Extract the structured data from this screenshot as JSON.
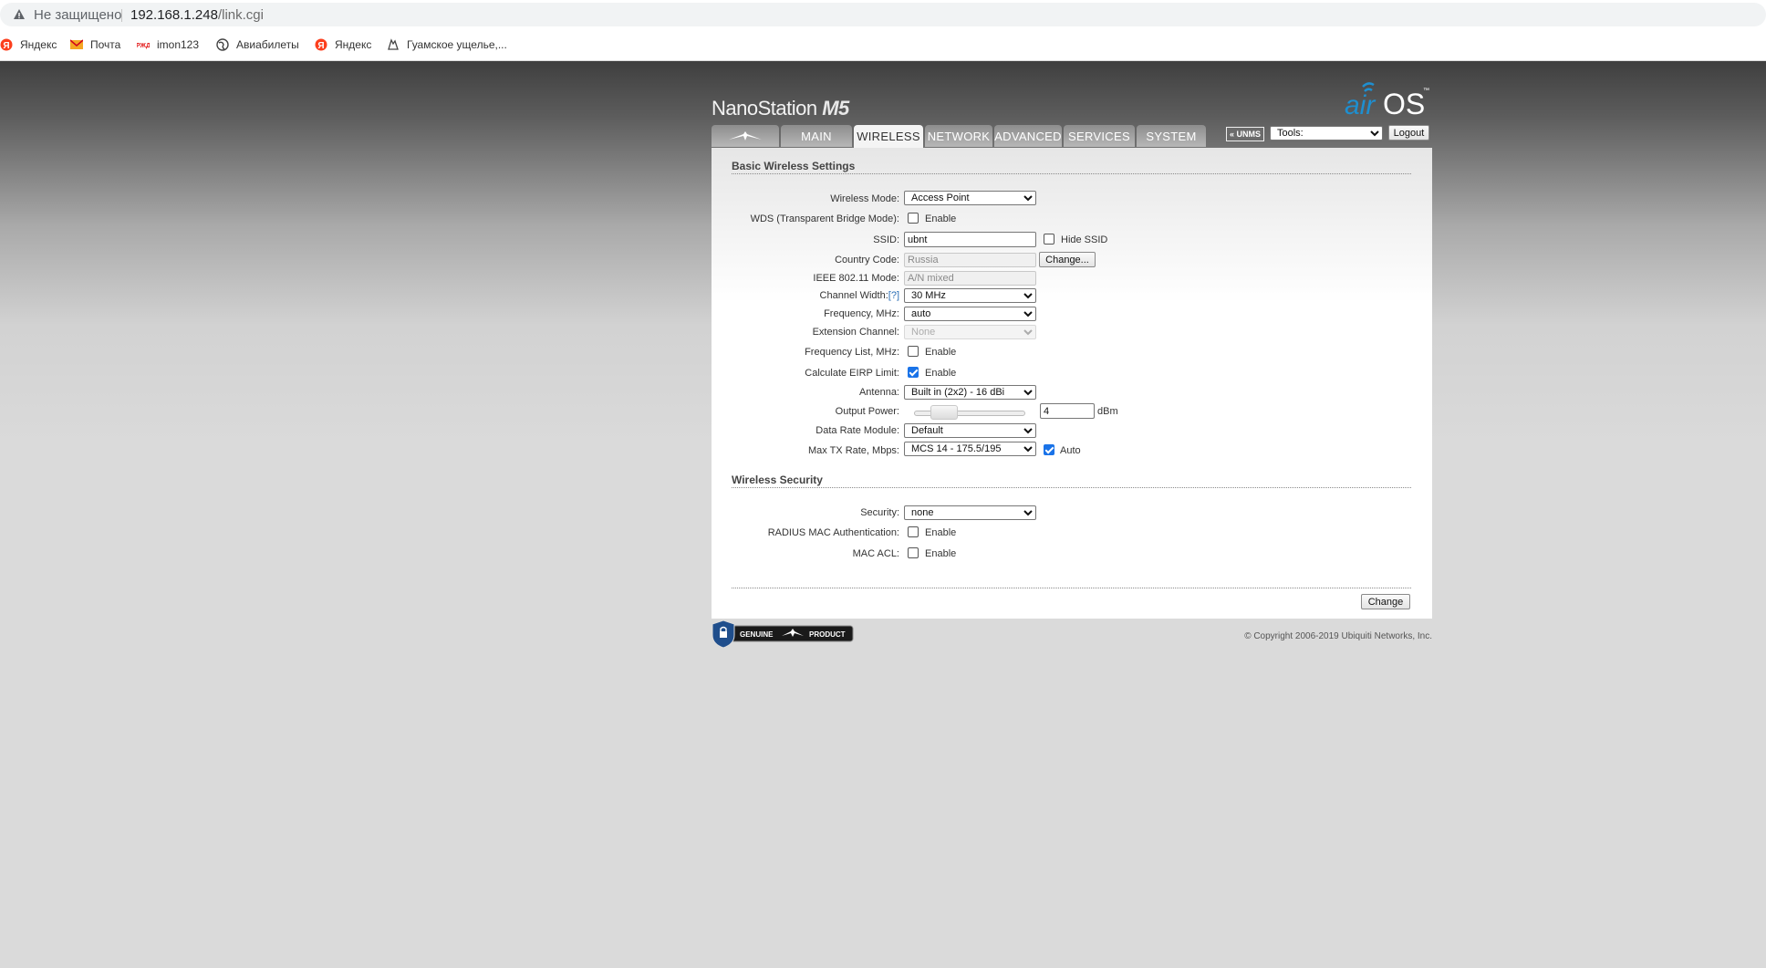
{
  "browser": {
    "security_label": "Не защищено",
    "url_host": "192.168.1.248",
    "url_path": "/link.cgi",
    "bookmarks": [
      {
        "label": "Яндекс",
        "icon": "yandex-icon"
      },
      {
        "label": "Почта",
        "icon": "mail-icon"
      },
      {
        "label": "imon123",
        "icon": "rzd-icon"
      },
      {
        "label": "Авиабилеты",
        "icon": "globe-icon"
      },
      {
        "label": "Яндекс",
        "icon": "yandex-icon"
      },
      {
        "label": "Гуамское ущелье,...",
        "icon": "map-icon"
      }
    ]
  },
  "header": {
    "product_name": "NanoStation",
    "product_model": "M5",
    "brand_air": "air",
    "brand_os": "OS",
    "tm": "™"
  },
  "tabs": [
    "MAIN",
    "WIRELESS",
    "NETWORK",
    "ADVANCED",
    "SERVICES",
    "SYSTEM"
  ],
  "active_tab": "WIRELESS",
  "toolbar": {
    "unms_label": "UNMS",
    "tools_value": "Tools:",
    "logout_label": "Logout"
  },
  "basic": {
    "title": "Basic Wireless Settings",
    "wireless_mode_label": "Wireless Mode:",
    "wireless_mode_value": "Access Point",
    "wds_label": "WDS (Transparent Bridge Mode):",
    "wds_enable_label": "Enable",
    "ssid_label": "SSID:",
    "ssid_value": "ubnt",
    "hide_ssid_label": "Hide SSID",
    "country_code_label": "Country Code:",
    "country_code_value": "Russia",
    "country_change_label": "Change...",
    "ieee_label": "IEEE 802.11 Mode:",
    "ieee_value": "A/N mixed",
    "channel_width_label": "Channel Width:",
    "channel_width_help": "[?]",
    "channel_width_value": "30 MHz",
    "frequency_label": "Frequency, MHz:",
    "frequency_value": "auto",
    "extension_label": "Extension Channel:",
    "extension_value": "None",
    "freq_list_label": "Frequency List, MHz:",
    "freq_list_enable_label": "Enable",
    "eirp_label": "Calculate EIRP Limit:",
    "eirp_enable_label": "Enable",
    "antenna_label": "Antenna:",
    "antenna_value": "Built in (2x2) - 16 dBi",
    "output_power_label": "Output Power:",
    "output_power_value": "4",
    "output_power_unit": "dBm",
    "data_rate_label": "Data Rate Module:",
    "data_rate_value": "Default",
    "max_tx_label": "Max TX Rate, Mbps:",
    "max_tx_value": "MCS 14 - 175.5/195",
    "max_tx_auto_label": "Auto"
  },
  "checks": {
    "wds": false,
    "hide_ssid": false,
    "freq_list": false,
    "eirp": true,
    "max_tx_auto": true,
    "radius": false,
    "mac_acl": false
  },
  "security": {
    "title": "Wireless Security",
    "security_label": "Security:",
    "security_value": "none",
    "radius_label": "RADIUS MAC Authentication:",
    "radius_enable_label": "Enable",
    "mac_acl_label": "MAC ACL:",
    "mac_acl_enable_label": "Enable"
  },
  "footer": {
    "change_label": "Change",
    "genuine_text": "GENUINE",
    "product_text": "PRODUCT",
    "copyright": "© Copyright 2006-2019 Ubiquiti Networks, Inc."
  }
}
